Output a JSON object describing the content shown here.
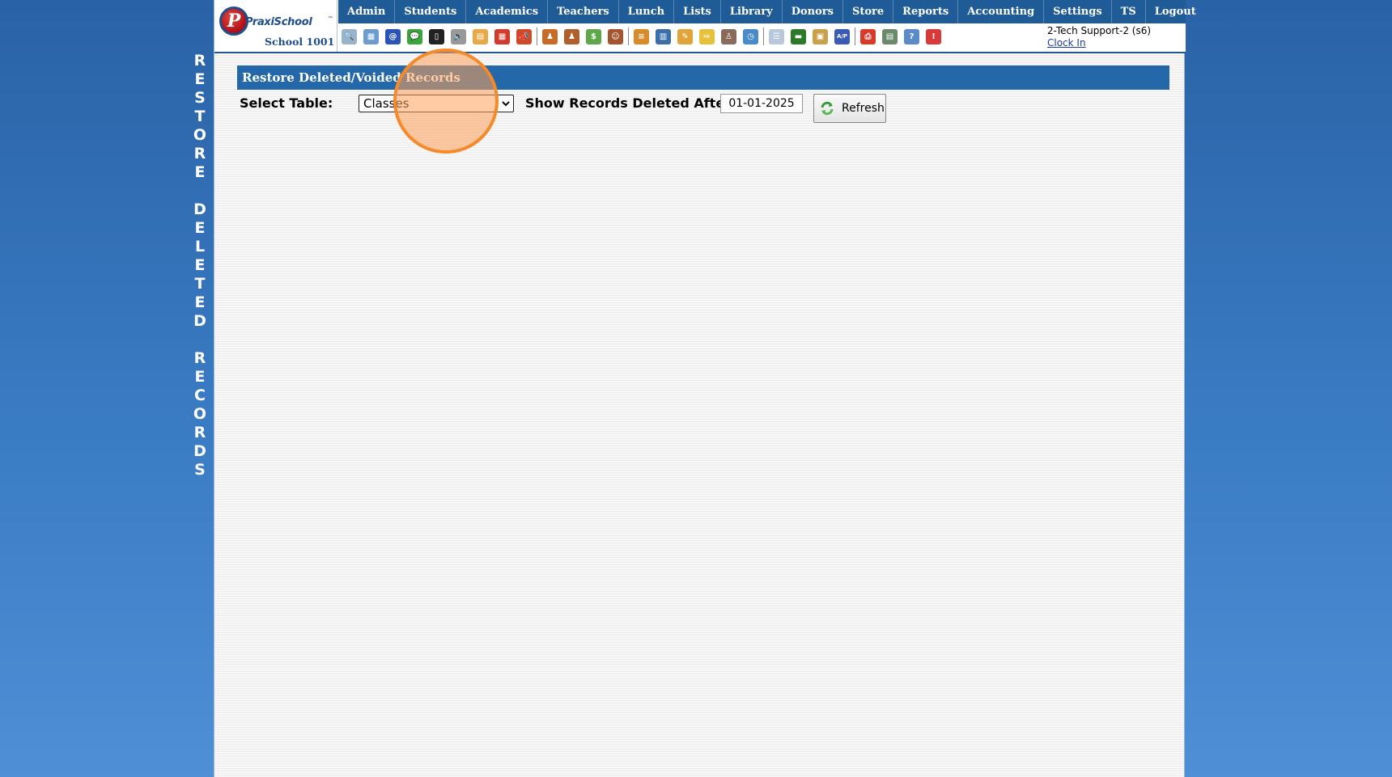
{
  "side_title": "RESTORE DELETED RECORDS",
  "logo": {
    "brand": "PraxiSchool",
    "tm": "™",
    "school": "School 1001",
    "letter": "P"
  },
  "menu": [
    "Admin",
    "Students",
    "Academics",
    "Teachers",
    "Lunch",
    "Lists",
    "Library",
    "Donors",
    "Store",
    "Reports",
    "Accounting",
    "Settings",
    "TS",
    "Logout"
  ],
  "toolbar": {
    "icons": [
      {
        "name": "search-icon",
        "color": "#9ab3cc",
        "glyph": "🔍"
      },
      {
        "name": "table-icon",
        "color": "#6b9bd1",
        "glyph": "▦"
      },
      {
        "name": "email-icon",
        "color": "#2a55b8",
        "glyph": "@"
      },
      {
        "name": "chat-icon",
        "color": "#3aa63a",
        "glyph": "💬"
      },
      {
        "name": "mobile-icon",
        "color": "#222222",
        "glyph": "▯"
      },
      {
        "name": "speaker-icon",
        "color": "#999999",
        "glyph": "🔈"
      },
      {
        "name": "calendar-grid-icon",
        "color": "#e8a848",
        "glyph": "▤"
      },
      {
        "name": "calendar-icon",
        "color": "#d23b2b",
        "glyph": "▦"
      },
      {
        "name": "megaphone-icon",
        "color": "#d04a2a",
        "glyph": "📣"
      },
      {
        "name": "sep"
      },
      {
        "name": "add-student-icon",
        "color": "#c66b2a",
        "glyph": "♟"
      },
      {
        "name": "student-icon",
        "color": "#b0602a",
        "glyph": "♟"
      },
      {
        "name": "money-icon",
        "color": "#5fa84a",
        "glyph": "$"
      },
      {
        "name": "family-icon",
        "color": "#a4542f",
        "glyph": "☺"
      },
      {
        "name": "sep"
      },
      {
        "name": "lunch-icon",
        "color": "#d88b2a",
        "glyph": "≡"
      },
      {
        "name": "book-icon",
        "color": "#3a6fa8",
        "glyph": "▥"
      },
      {
        "name": "pencil-icon",
        "color": "#e0a43a",
        "glyph": "✎"
      },
      {
        "name": "import-icon",
        "color": "#e8c13a",
        "glyph": "⇨"
      },
      {
        "name": "teacher-icon",
        "color": "#8a6a5a",
        "glyph": "♙"
      },
      {
        "name": "clock-icon",
        "color": "#4a8ac8",
        "glyph": "◷"
      },
      {
        "name": "sep"
      },
      {
        "name": "list-icon",
        "color": "#b8c8dc",
        "glyph": "☰"
      },
      {
        "name": "card-icon",
        "color": "#2a7a2a",
        "glyph": "▬"
      },
      {
        "name": "register-icon",
        "color": "#c8a24a",
        "glyph": "▣"
      },
      {
        "name": "ap-icon",
        "color": "#3a5ab8",
        "glyph": "A/P"
      },
      {
        "name": "sep"
      },
      {
        "name": "pdf-icon",
        "color": "#d83a2a",
        "glyph": "⎙"
      },
      {
        "name": "cash-icon",
        "color": "#6a8a6a",
        "glyph": "▤"
      },
      {
        "name": "help-icon",
        "color": "#5a8ac8",
        "glyph": "?"
      },
      {
        "name": "alert-icon",
        "color": "#d83a3a",
        "glyph": "!"
      }
    ]
  },
  "user": {
    "name": "2-Tech Support-2 (s6)",
    "clock_in": "Clock In"
  },
  "panel": {
    "title": "Restore Deleted/Voided Records",
    "select_label": "Select Table:",
    "select_value": "Classes",
    "show_label": "Show Records Deleted After",
    "date_value": "01-01-2025",
    "refresh_label": "Refresh"
  }
}
